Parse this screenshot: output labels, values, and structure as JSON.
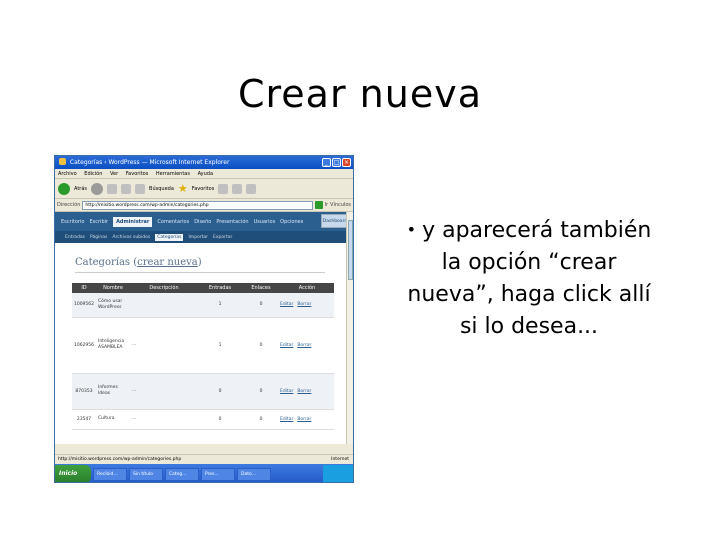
{
  "slide": {
    "title": "Crear nueva",
    "bullet_text": "y aparecerá también la opción “crear nueva”, haga click allí si lo desea..."
  },
  "window": {
    "title": "Categorías ‹ WordPress — Microsoft Internet Explorer",
    "menu": [
      "Archivo",
      "Edición",
      "Ver",
      "Favoritos",
      "Herramientas",
      "Ayuda"
    ],
    "toolbar": {
      "back": "Atrás",
      "search": "Búsqueda",
      "favorites": "Favoritos"
    },
    "address_label": "Dirección",
    "address_value": "http://misitio.wordpress.com/wp-admin/categories.php",
    "go_label": "Ir",
    "links_label": "Vínculos",
    "status_text": "http://misitio.wordpress.com/wp-admin/categories.php",
    "status_zone": "Internet"
  },
  "wp": {
    "nav": [
      "Escritorio",
      "Escribir",
      "Administrar",
      "Comentarios",
      "Diseño",
      "Presentación",
      "Usuarios",
      "Opciones"
    ],
    "nav_active_index": 2,
    "dashboard_button": "Dashboard",
    "subnav": [
      "Entradas",
      "Páginas",
      "Archivos subidos",
      "Categorías",
      "Importar",
      "Exportar"
    ],
    "subnav_active_index": 3,
    "heading": "Categorías",
    "heading_link": "crear nueva",
    "columns": [
      "ID",
      "Nombre",
      "Descripción",
      "Entradas",
      "Enlaces",
      "Acción"
    ],
    "rows": [
      {
        "id": "1009562",
        "name": "Cómo usar WordPress",
        "desc": "",
        "posts": "1",
        "links": "0",
        "edit": "Editar",
        "delete": "Borrar"
      },
      {
        "id": "1062956",
        "name": "Inteligencia ASAMBLEA",
        "desc": "...",
        "posts": "1",
        "links": "0",
        "edit": "Editar",
        "delete": "Borrar"
      },
      {
        "id": "870353",
        "name": "Informes Ideas",
        "desc": "...",
        "posts": "0",
        "links": "0",
        "edit": "Editar",
        "delete": "Borrar"
      },
      {
        "id": "23547",
        "name": "Cultura",
        "desc": "...",
        "posts": "0",
        "links": "0",
        "edit": "Editar",
        "delete": "Borrar"
      }
    ]
  },
  "taskbar": {
    "start": "Inicio",
    "tasks": [
      "Recibid...",
      "Sin título",
      "Categ...",
      "Pres...",
      "Dato..."
    ]
  }
}
